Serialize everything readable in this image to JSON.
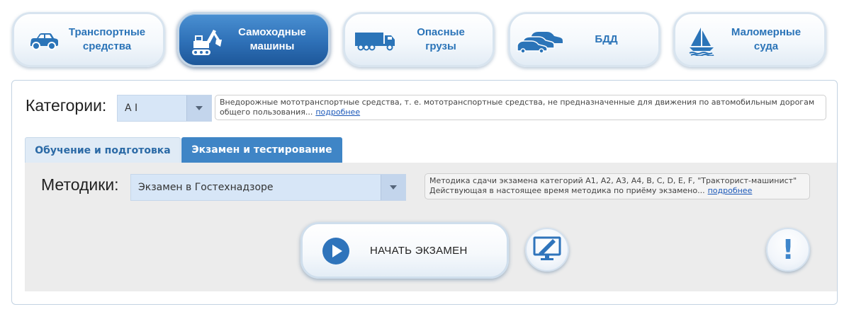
{
  "nav": {
    "items": [
      {
        "label": "Транспортные\nсредства",
        "icon": "car-icon"
      },
      {
        "label": "Самоходные\nмашины",
        "icon": "excavator-icon",
        "active": true
      },
      {
        "label": "Опасные\nгрузы",
        "icon": "truck-icon"
      },
      {
        "label": "БДД",
        "icon": "cars-icon"
      },
      {
        "label": "Маломерные\nсуда",
        "icon": "sailboat-icon"
      }
    ]
  },
  "categories": {
    "label": "Категории:",
    "selected": "A I",
    "description": "Внедорожные мототранспортные средства, т. е. мототранспортные средства, не предназначенные для движения по автомобильным дорогам общего пользования...",
    "more_link": "подробнее"
  },
  "tabs": [
    {
      "label": "Обучение и подготовка"
    },
    {
      "label": "Экзамен и тестирование",
      "active": true
    }
  ],
  "methods": {
    "label": "Методики:",
    "selected": "Экзамен в Гостехнадзоре",
    "description_line1": "Методика сдачи экзамена категорий A1, A2, A3, A4, B, C, D, E, F, \"Тракторист-машинист\"",
    "description_line2": "Действующая в настоящее время методика по приёму экзамено...",
    "more_link": "подробнее"
  },
  "actions": {
    "start_label": "НАЧАТЬ ЭКЗАМЕН",
    "exclamation": "!"
  },
  "colors": {
    "accent": "#2f74bb",
    "nav_text": "#2b74b8",
    "tab_active": "#3f85c6",
    "select_bg": "#d7e6f7",
    "link": "#1a57b8"
  }
}
